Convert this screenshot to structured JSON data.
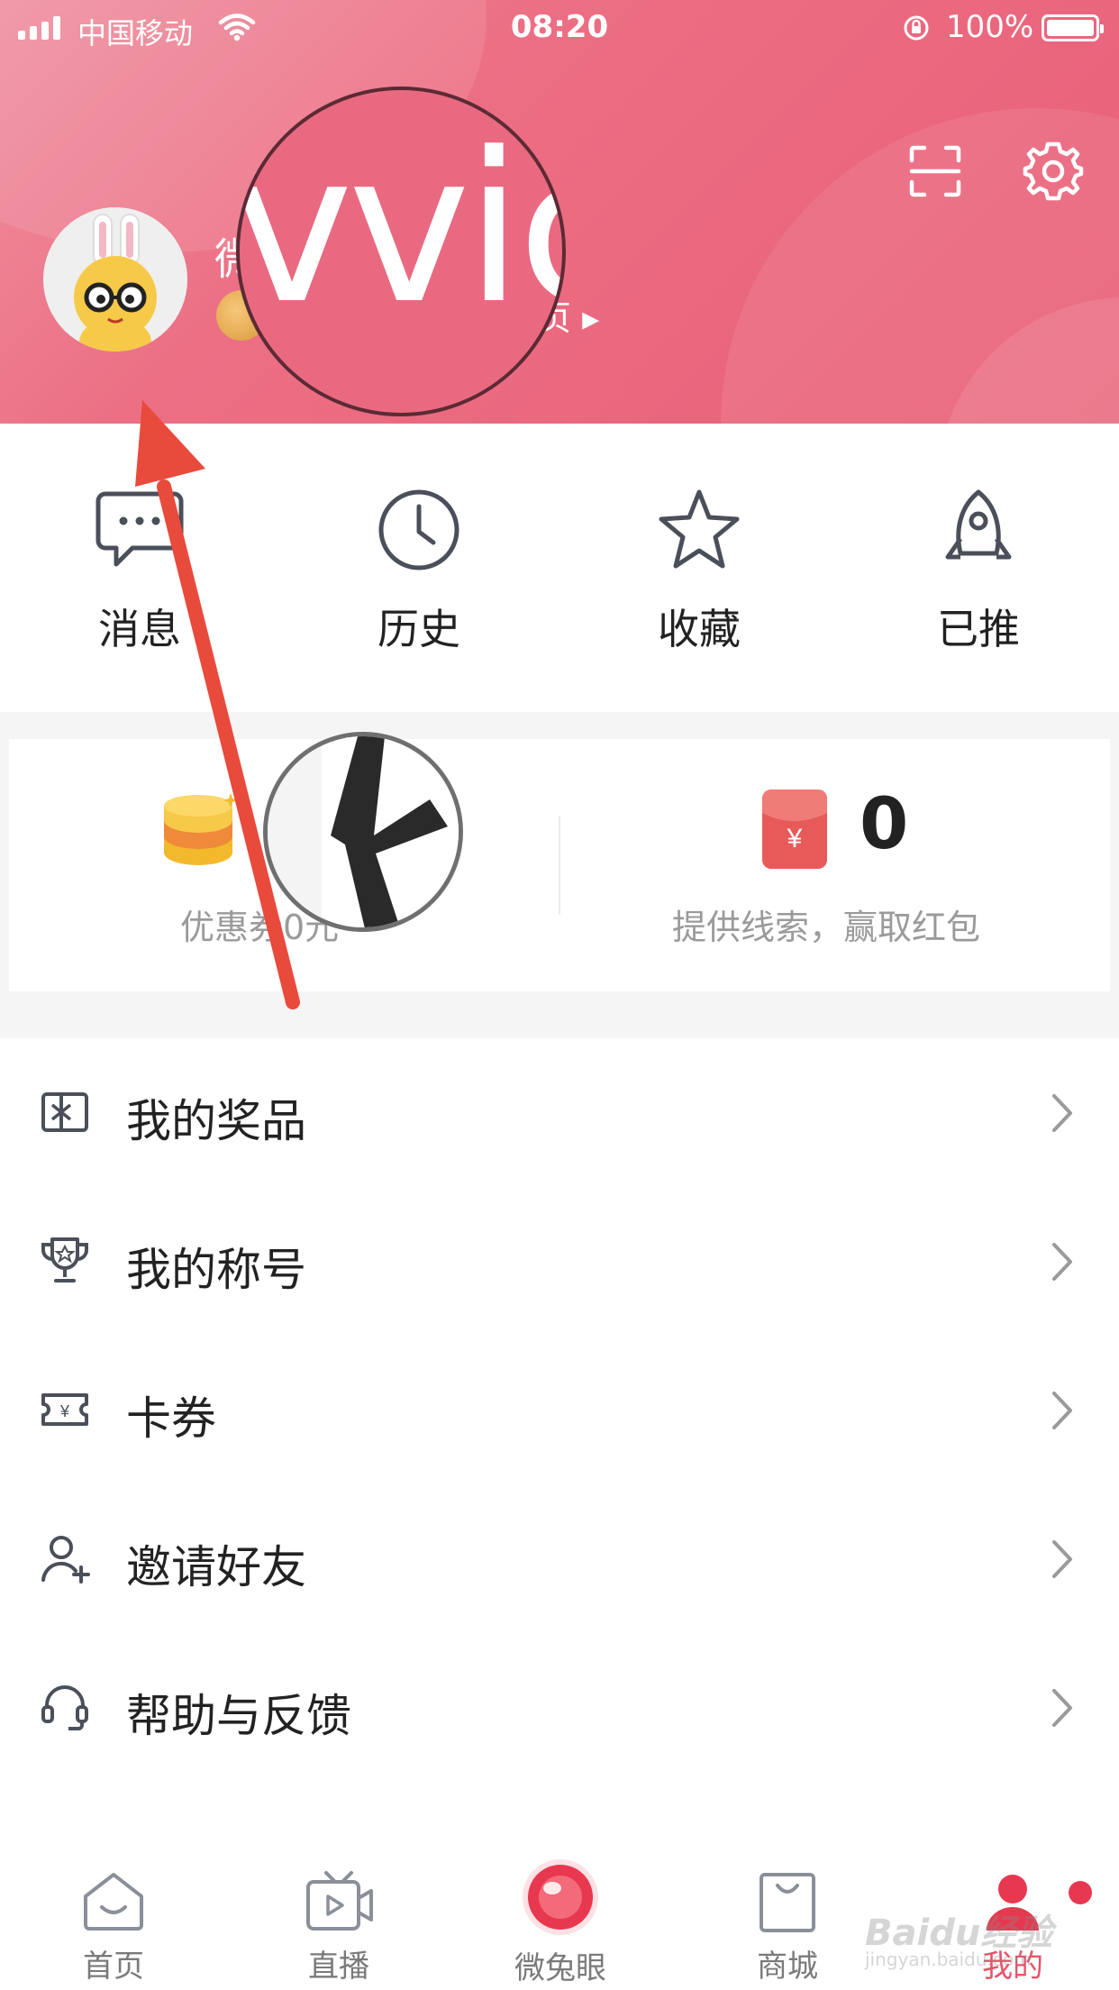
{
  "status_bar": {
    "carrier": "中国移动",
    "time": "08:20",
    "battery": "100%"
  },
  "profile": {
    "username_partial": "微",
    "homepage_link": "页 ▸",
    "magnifier_text": "vvic"
  },
  "quick_actions": [
    {
      "label": "消息",
      "icon": "message-icon"
    },
    {
      "label": "历史",
      "icon": "clock-icon"
    },
    {
      "label": "收藏",
      "icon": "star-icon"
    },
    {
      "label": "已推",
      "icon": "rocket-icon"
    }
  ],
  "rewards": {
    "coupon_text": "优惠券0元",
    "redpacket_count": "0",
    "clue_text": "提供线索，赢取红包"
  },
  "menu": [
    {
      "label": "我的奖品",
      "icon": "gift-icon"
    },
    {
      "label": "我的称号",
      "icon": "trophy-icon"
    },
    {
      "label": "卡券",
      "icon": "ticket-icon"
    },
    {
      "label": "邀请好友",
      "icon": "add-user-icon"
    },
    {
      "label": "帮助与反馈",
      "icon": "headset-icon"
    }
  ],
  "tabs": [
    {
      "label": "首页",
      "icon": "home-icon"
    },
    {
      "label": "直播",
      "icon": "tv-icon"
    },
    {
      "label": "微兔眼",
      "icon": "eye-icon"
    },
    {
      "label": "商城",
      "icon": "bag-icon"
    },
    {
      "label": "我的",
      "icon": "profile-icon"
    }
  ],
  "watermark": {
    "brand": "Baidu经验",
    "url": "jingyan.baidu.com"
  },
  "colors": {
    "header": "#ec6f84",
    "accent": "#e8536a",
    "annotation_arrow": "#e84a3c"
  }
}
